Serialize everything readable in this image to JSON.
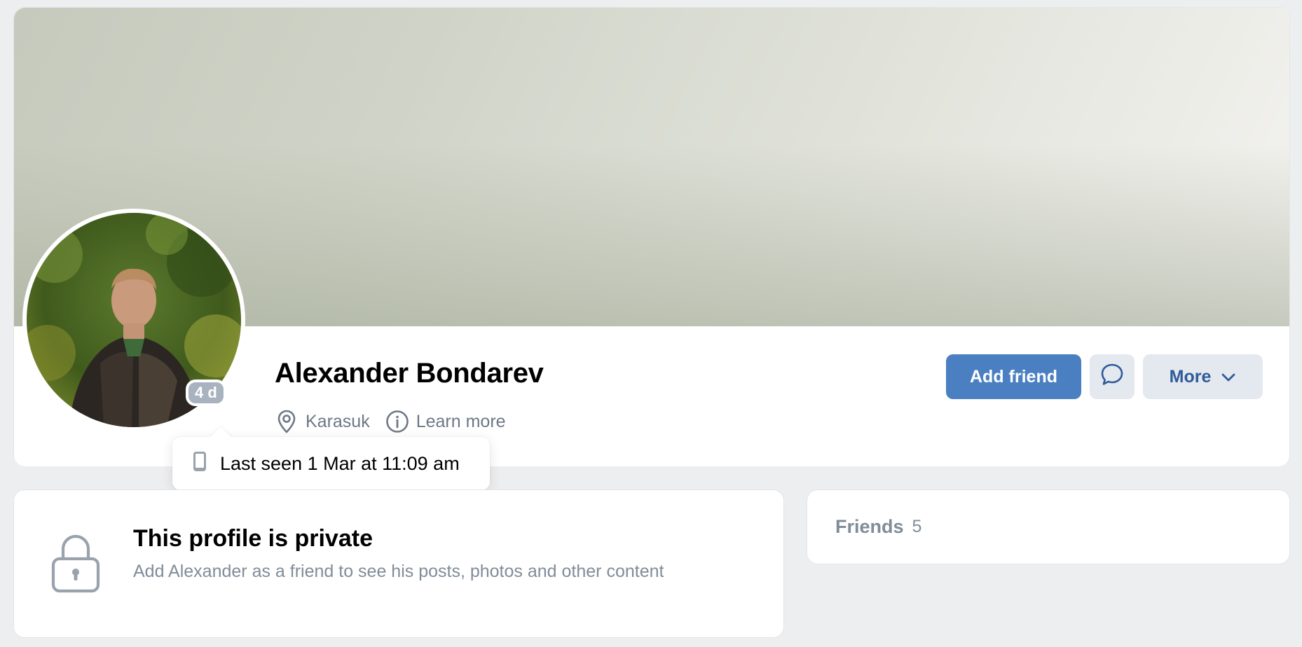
{
  "profile": {
    "name": "Alexander Bondarev",
    "online_badge": "4 d",
    "location": "Karasuk",
    "learn_more": "Learn more",
    "icons": {
      "location": "location-pin-icon",
      "info": "info-icon"
    }
  },
  "actions": {
    "add_friend": "Add friend",
    "message_icon": "message-bubble-icon",
    "more": "More"
  },
  "tooltip": {
    "text": "Last seen 1 Mar at 11:09 am",
    "icon": "mobile-phone-icon"
  },
  "private": {
    "title": "This profile is private",
    "text": "Add Alexander as a friend to see his posts, photos and other content",
    "icon": "lock-icon"
  },
  "friends": {
    "label": "Friends",
    "count": "5"
  },
  "colors": {
    "primary": "#4a7fc1",
    "secondary_bg": "#e4e8ef",
    "secondary_text": "#2e5c99",
    "muted_text": "#818c99",
    "page_bg": "#edeef0",
    "badge": "#a9b3c0"
  }
}
